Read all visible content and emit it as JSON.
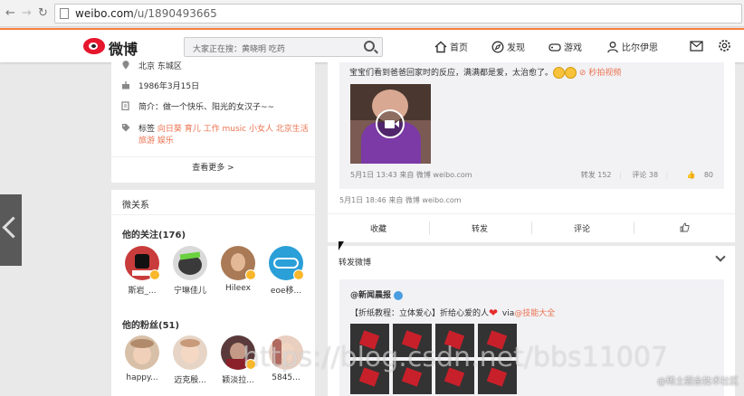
{
  "browser": {
    "url_host": "weibo.com",
    "url_path": "/u/1890493665"
  },
  "header": {
    "logo_text": "微博",
    "search_placeholder": "大家正在搜：黄晓明 吃药",
    "nav": [
      {
        "label": "首页",
        "icon": "home-icon"
      },
      {
        "label": "发现",
        "icon": "compass-icon"
      },
      {
        "label": "游戏",
        "icon": "gamepad-icon"
      },
      {
        "label": "比尔伊思",
        "icon": "user-icon"
      }
    ]
  },
  "profile_info": {
    "location": "北京 东城区",
    "birthday": "1986年3月15日",
    "intro": "简介：做一个快乐、阳光的女汉子~~",
    "tags_label": "标签",
    "tags_line1": "向日葵 育儿 工作 music 小女人 北京生活",
    "tags_line2": "旅游 娱乐",
    "more": "查看更多 >"
  },
  "relations": {
    "title": "微关系",
    "following_label": "他的关注(176)",
    "following": [
      {
        "name": "斯岩_...",
        "color": "#c83c3c"
      },
      {
        "name": "宁琳佳儿",
        "color": "#3a3a3a"
      },
      {
        "name": "Hileex",
        "color": "#a97a55"
      },
      {
        "name": "eoe移...",
        "color": "#2a9fd8"
      }
    ],
    "followers_label": "他的粉丝(51)",
    "followers": [
      {
        "name": "happy...",
        "color": "#b08a6a"
      },
      {
        "name": "迈克殷...",
        "color": "#c89a7a"
      },
      {
        "name": "颖淡拉...",
        "color": "#5a3a3a"
      },
      {
        "name": "5845...",
        "color": "#b06a60"
      }
    ]
  },
  "post1": {
    "text": "宝宝们看到爸爸回家时的反应，满满都是爱，太治愈了。",
    "video_link": "秒拍视频",
    "meta": "5月1日 13:43 来自 微博 weibo.com",
    "repost": "转发 152",
    "comment": "评论 38",
    "like": "80",
    "outer_meta": "5月1日 18:46 来自 微博 weibo.com",
    "actions": [
      "收藏",
      "转发",
      "评论"
    ]
  },
  "post2": {
    "header": "转发微博",
    "author": "@新闻晨报",
    "body_prefix": "【折纸教程：立体爱心】折给心爱的人",
    "via": "via",
    "via_link": "@技能大全"
  },
  "overlay": {
    "watermark": "https://blog.csdn.net/bbs11007",
    "credit": "@稀土掘金技术社区"
  },
  "colors": {
    "accent": "#fa7d3c",
    "link": "#eb7350",
    "weibo_red": "#e6162d"
  }
}
